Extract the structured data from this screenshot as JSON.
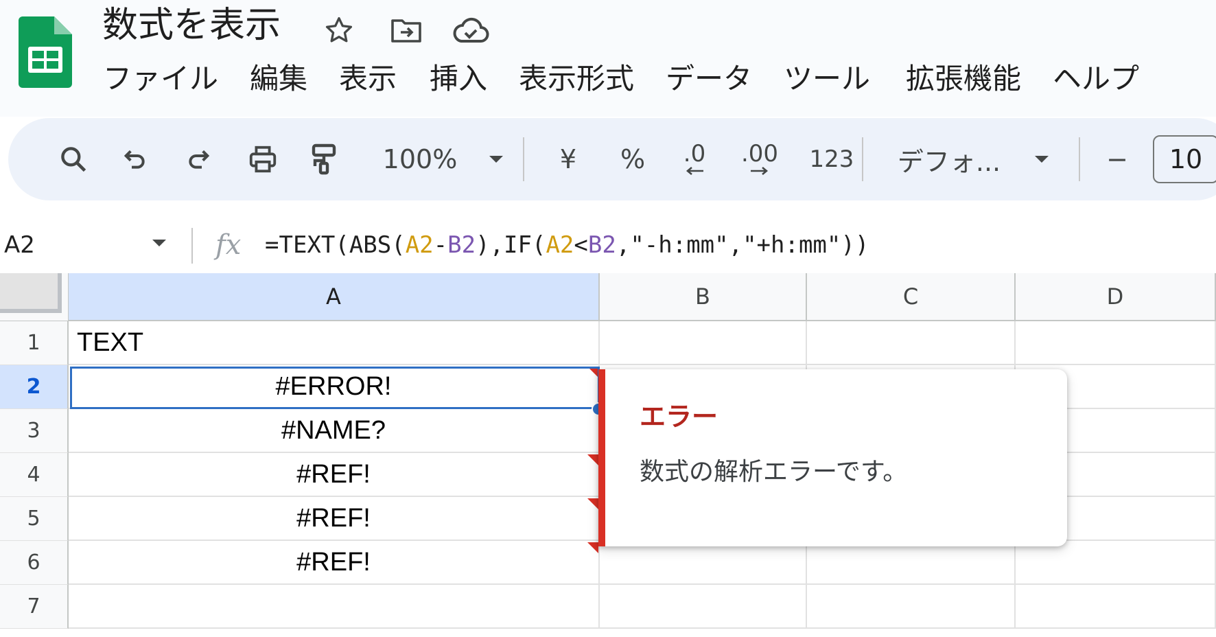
{
  "document": {
    "title": "数式を表示"
  },
  "header_icons": [
    "star-icon",
    "move-to-folder-icon",
    "cloud-saved-icon"
  ],
  "menu": [
    "ファイル",
    "編集",
    "表示",
    "挿入",
    "表示形式",
    "データ",
    "ツール",
    "拡張機能",
    "ヘルプ"
  ],
  "toolbar": {
    "zoom": "100%",
    "currency": "¥",
    "percent": "%",
    "decrease_decimal": ".0",
    "increase_decimal": ".00",
    "number_format": "123",
    "font": "デフォ...",
    "font_size_minus": "−",
    "font_size": "10"
  },
  "formula_bar": {
    "name_box": "A2",
    "fx": "fx",
    "formula_parts": [
      "=TEXT(ABS(",
      "A2",
      "-",
      "B2",
      "),IF(",
      "A2",
      "<",
      "B2",
      ",\"-h:mm\",\"+h:mm\"))"
    ]
  },
  "grid": {
    "columns": [
      "A",
      "B",
      "C",
      "D"
    ],
    "rows": [
      "1",
      "2",
      "3",
      "4",
      "5",
      "6",
      "7"
    ],
    "selected_column": "A",
    "selected_row": "2",
    "cells_a": [
      "TEXT",
      "#ERROR!",
      "#NAME?",
      "#REF!",
      "#REF!",
      "#REF!",
      ""
    ]
  },
  "error_popup": {
    "title": "エラー",
    "message": "数式の解析エラーです。"
  },
  "colors": {
    "accent": "#0b57d0",
    "error": "#d93025",
    "sheets_green": "#0f9d58"
  }
}
